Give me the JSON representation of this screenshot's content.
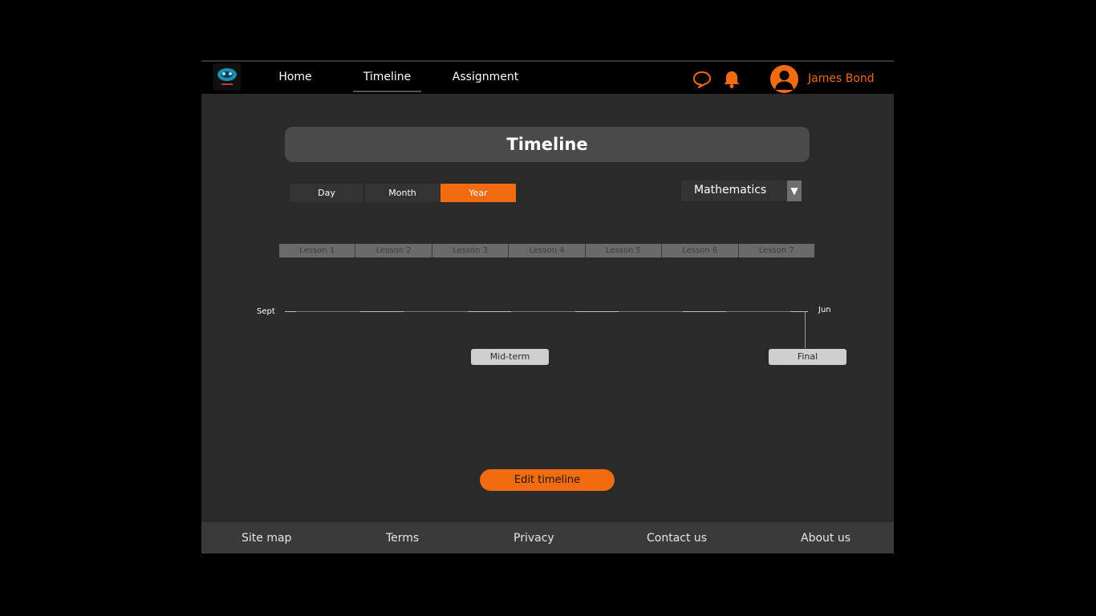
{
  "nav": {
    "home": "Home",
    "timeline": "Timeline",
    "assignment": "Assignment",
    "active": "Timeline"
  },
  "header": {
    "user_name": "James Bond",
    "icons": [
      "logo-icon",
      "chat-icon",
      "bell-icon",
      "user-avatar-icon"
    ],
    "accent_color": "#f26b0f"
  },
  "page": {
    "title": "Timeline"
  },
  "view_toggle": {
    "options": [
      "Day",
      "Month",
      "Year"
    ],
    "selected": "Year"
  },
  "subject": {
    "selected": "Mathematics",
    "arrow": "▼"
  },
  "lessons": [
    "Lesson 1",
    "Lesson 2",
    "Lesson 3",
    "Lesson 4",
    "Lesson 5",
    "Lesson 6",
    "Lesson 7"
  ],
  "timeline": {
    "start_label": "Sept",
    "end_label": "Jun",
    "milestones": [
      "Mid-term",
      "Final"
    ]
  },
  "actions": {
    "edit_label": "Edit timeline"
  },
  "footer": {
    "links": [
      "Site map",
      "Terms",
      "Privacy",
      "Contact us",
      "About us"
    ]
  }
}
